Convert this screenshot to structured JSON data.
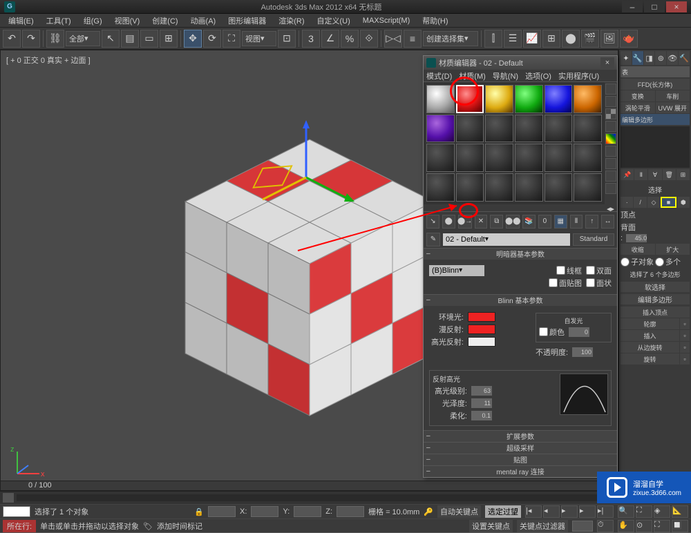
{
  "titlebar": {
    "title": "Autodesk 3ds Max 2012 x64   无标题"
  },
  "menubar": {
    "items": [
      "编辑(E)",
      "工具(T)",
      "组(G)",
      "视图(V)",
      "创建(C)",
      "动画(A)",
      "图形编辑器",
      "渲染(R)",
      "自定义(U)",
      "MAXScript(M)",
      "帮助(H)"
    ]
  },
  "toolbar": {
    "preset": "全部",
    "viewlabel": "视图",
    "createset": "创建选择集"
  },
  "viewport": {
    "label": "[ + 0 正交 0 真实 + 边面 ]",
    "timeline": "0 / 100"
  },
  "material_editor": {
    "title": "材质编辑器 - 02 - Default",
    "menu": [
      "模式(D)",
      "材质(M)",
      "导航(N)",
      "选项(O)",
      "实用程序(U)"
    ],
    "name": "02 - Default",
    "standard_btn": "Standard",
    "rollout_shader_hdr": "明暗器基本参数",
    "shader_type": "(B)Blinn",
    "chk_wire": "线框",
    "chk_2side": "双面",
    "chk_facemap": "面贴图",
    "chk_faceted": "面状",
    "rollout_blinn_hdr": "Blinn 基本参数",
    "self_illum_grp": "自发光",
    "chk_color": "颜色",
    "self_illum_val": "0",
    "lbl_ambient": "环境光:",
    "lbl_diffuse": "漫反射:",
    "lbl_spec": "高光反射:",
    "lbl_opacity": "不透明度:",
    "opacity_val": "100",
    "grp_spec": "反射高光",
    "lbl_spec_level": "高光级别:",
    "spec_level": "63",
    "lbl_gloss": "光泽度:",
    "gloss": "11",
    "lbl_soften": "柔化:",
    "soften": "0.1",
    "rollout_ext": "扩展参数",
    "rollout_super": "超级采样",
    "rollout_maps": "贴图",
    "rollout_mr": "mental ray 连接"
  },
  "right_panel": {
    "dropdown": "表",
    "btn_ffd": "FFD(长方体)",
    "btn_trans": "变换",
    "btn_car": "车削",
    "btn_turbo": "涡轮平滑",
    "btn_uvw": "UVW 展开",
    "item_editpoly": "编辑多边形",
    "section_sel": "选择",
    "sub_vertex": "顶点",
    "sub_backface": "背面",
    "angle": "45.0",
    "btn_shrink": "收缩",
    "btn_grow": "扩大",
    "chk_obj": "子对象",
    "chk_many": "多个",
    "sel_status": "选择了 6 个多边形",
    "section_soft": "软选择",
    "section_editpoly": "编辑多边形",
    "btn_insvert": "插入顶点",
    "btn_outline": "轮廓",
    "btn_insert": "插入",
    "btn_fromedge": "从边旋转",
    "btn_rotate": "旋转"
  },
  "status": {
    "selection": "选择了 1 个对象",
    "current_line": "所在行:",
    "prompt": "单击或单击并拖动以选择对象",
    "add_key": "添加时间标记",
    "coord_x": "X:",
    "coord_y": "Y:",
    "coord_z": "Z:",
    "grid": "栅格 = 10.0mm",
    "autokey": "自动关键点",
    "selkey": "选定过望",
    "setkey": "设置关键点",
    "keyfilter": "关键点过滤器"
  },
  "watermark": {
    "main": "溜溜自学",
    "sub": "zixue.3d66.com"
  }
}
